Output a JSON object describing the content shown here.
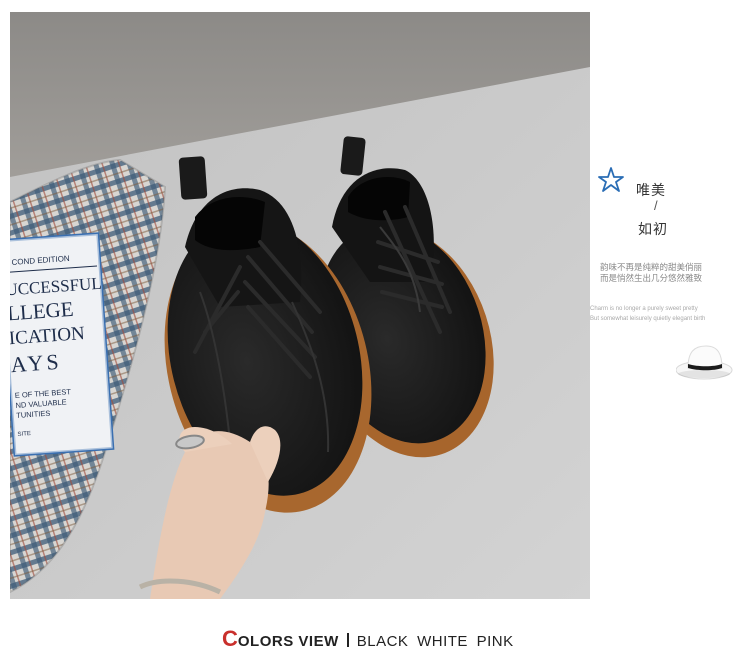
{
  "product_photo": {
    "subject": "black leather lace-up shoes",
    "book_cover_lines": [
      "COND EDITION",
      "UCCESSFUL",
      "LLEGE",
      "ICATION",
      "AYS",
      "E OF THE BEST",
      "ND VALUABLE",
      "TUNITIES",
      "SITE"
    ]
  },
  "side_panel": {
    "title_line1": "唯美",
    "slash": "/",
    "title_line2": "如初",
    "cn_line1": "韵味不再是纯粹的甜美俏丽",
    "cn_line2": "而是悄然生出几分悠然雅致",
    "en_line1": "Charm is no longer a purely sweet pretty",
    "en_line2": "But somewhat leisurely quietly elegant birth",
    "accent_color": "#2a6db5"
  },
  "footer": {
    "c_letter": "C",
    "colors_label": "OLORS VIEW",
    "colors_values": "BLACK WHITE PINK",
    "accent_color": "#c9302c"
  }
}
